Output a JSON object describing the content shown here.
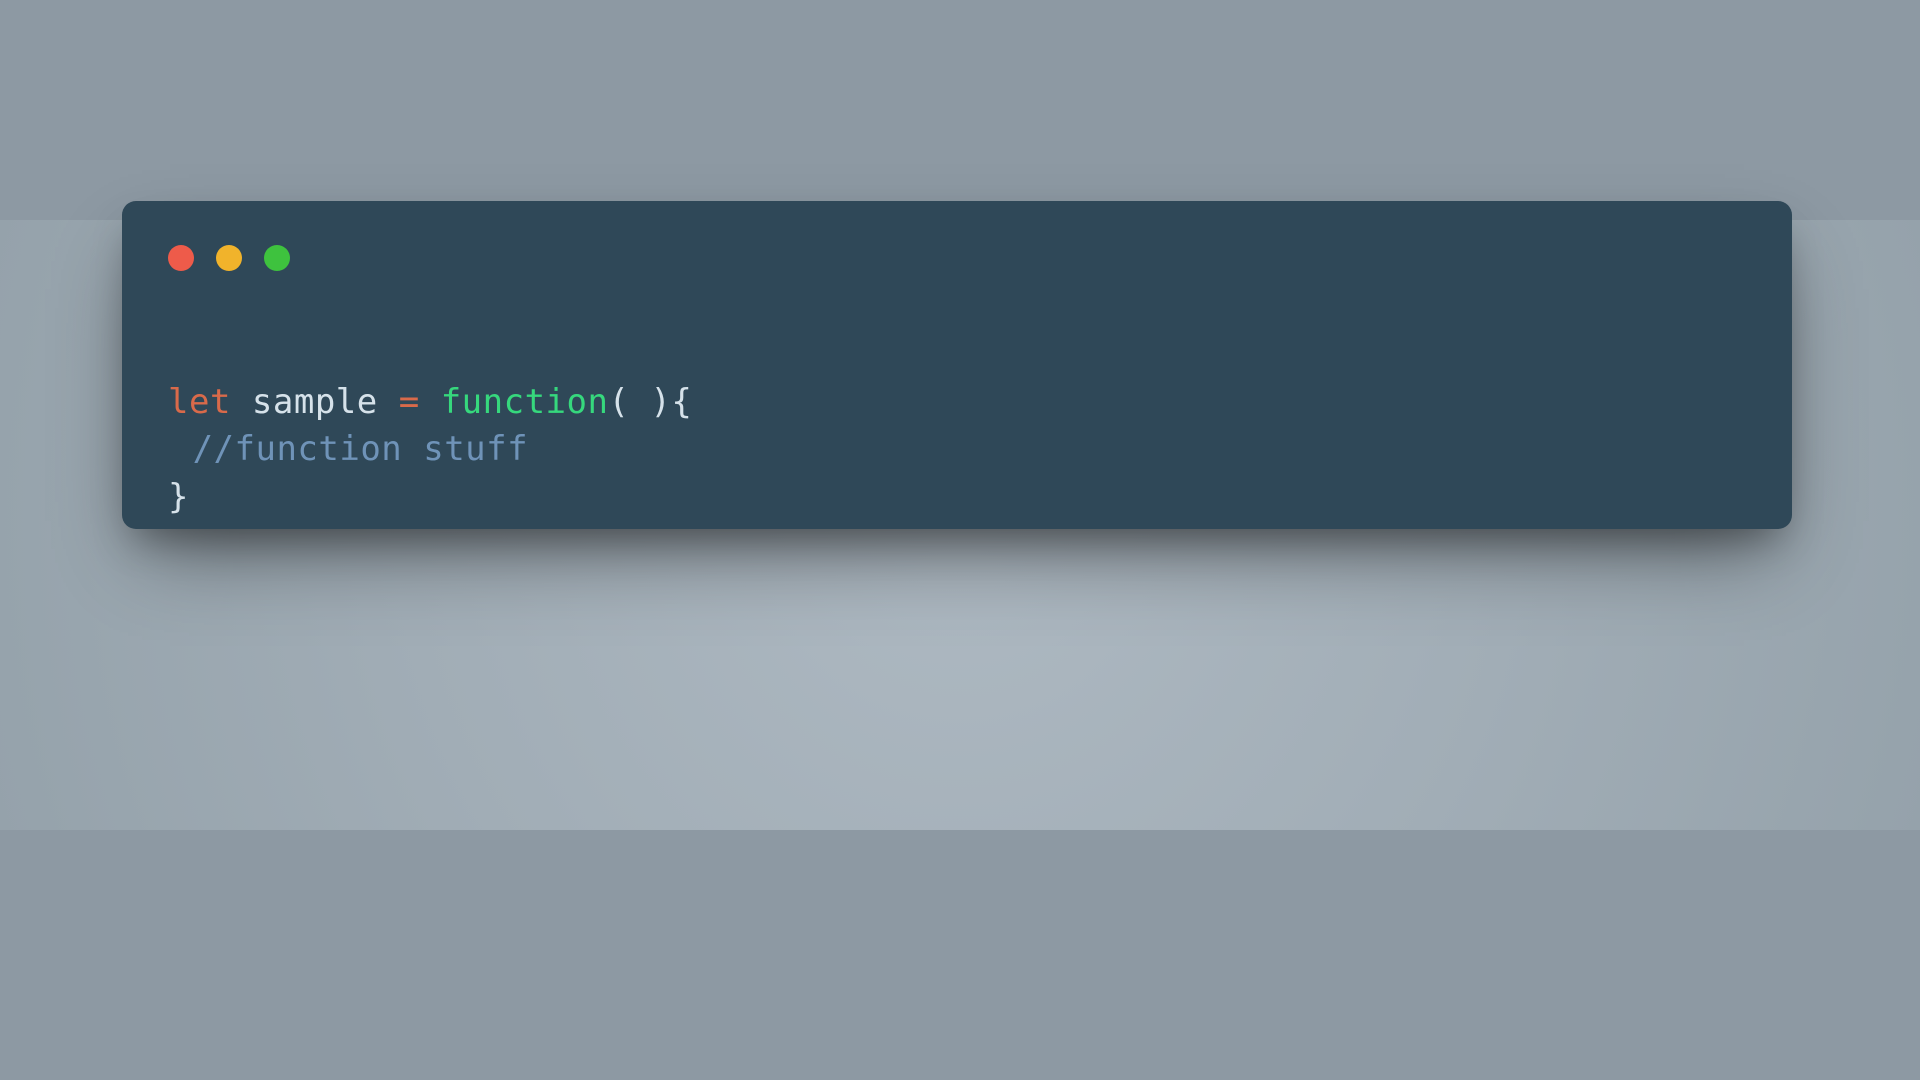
{
  "window": {
    "traffic_lights": {
      "red": "#ee5b4a",
      "yellow": "#f1b32b",
      "green": "#3ec23e"
    }
  },
  "code": {
    "line1": {
      "keyword": "let",
      "ident": "sample",
      "equals": "=",
      "funcword": "function",
      "parens": "( )",
      "openBrace": "{"
    },
    "line2": {
      "comment": "//function stuff"
    },
    "line3": {
      "closeBrace": "}"
    }
  }
}
